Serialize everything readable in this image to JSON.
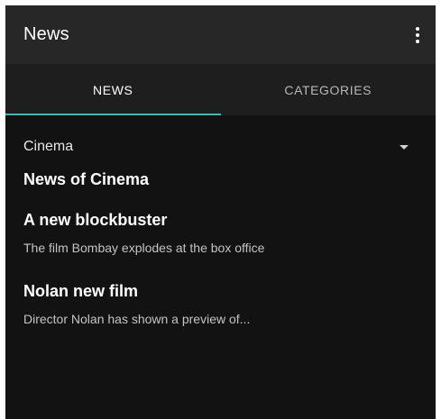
{
  "appbar": {
    "title": "News"
  },
  "tabs": [
    {
      "label": "NEWS",
      "active": true
    },
    {
      "label": "CATEGORIES",
      "active": false
    }
  ],
  "category_select": {
    "value": "Cinema"
  },
  "section": {
    "title": "News of Cinema"
  },
  "news": [
    {
      "title": "A new blockbuster",
      "description": "The film Bombay explodes at the box office"
    },
    {
      "title": "Nolan new film",
      "description": "Director Nolan has shown a preview of..."
    }
  ],
  "colors": {
    "background": "#121212",
    "appbar": "#272727",
    "tabbar": "#1e1e1e",
    "accent": "#4fb3b0"
  }
}
